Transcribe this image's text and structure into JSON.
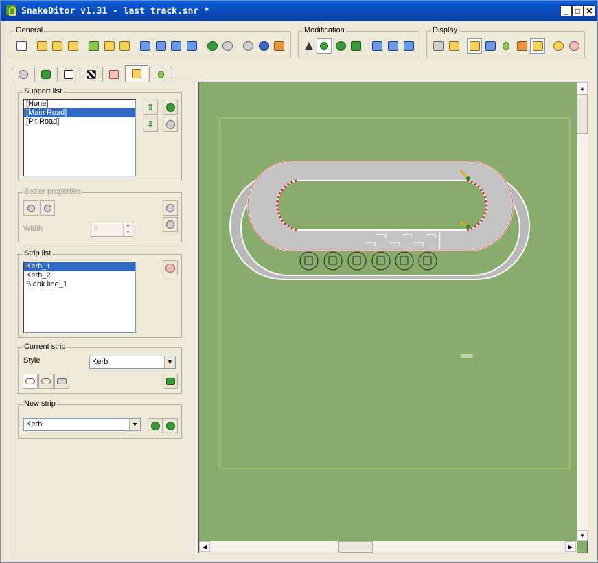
{
  "window": {
    "title": "SnakeDitor v1.31 - last track.snr *",
    "controls": {
      "minimize": "_",
      "maximize": "□",
      "close": "✕"
    }
  },
  "toolbar": {
    "general_label": "General",
    "modification_label": "Modification",
    "display_label": "Display"
  },
  "tabs": [
    {
      "icon": "gear-icon"
    },
    {
      "icon": "track-icon"
    },
    {
      "icon": "elevation-icon"
    },
    {
      "icon": "checkered-flag-icon"
    },
    {
      "icon": "curve-icon"
    },
    {
      "icon": "brush-icon"
    },
    {
      "icon": "tree-icon"
    }
  ],
  "support_list": {
    "label": "Support list",
    "items": [
      "[None]",
      "[Main Road]",
      "[Pit Road]"
    ],
    "selected_index": 1,
    "move_up": "⇧",
    "move_down": "⇩"
  },
  "bezier": {
    "label": "Bezier properties",
    "width_label": "Width",
    "width_value": "0"
  },
  "strip_list": {
    "label": "Strip list",
    "items": [
      "Kerb_1",
      "Kerb_2",
      "Blank line_1"
    ],
    "selected_index": 0
  },
  "current_strip": {
    "label": "Current strip",
    "style_label": "Style",
    "style_value": "Kerb"
  },
  "new_strip": {
    "label": "New strip",
    "value": "Kerb"
  },
  "colors": {
    "title_bar": "#0a52c8",
    "canvas": "#88ac6c",
    "selection": "#316ac5",
    "track": "#c0c0c0",
    "kerb": "#d83030"
  }
}
